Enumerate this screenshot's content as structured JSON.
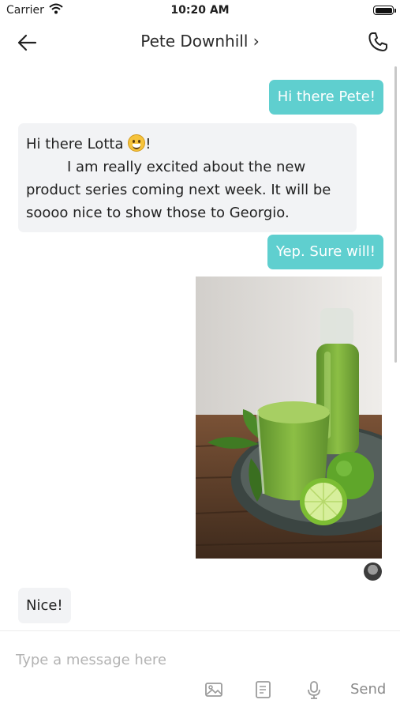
{
  "status_bar": {
    "carrier": "Carrier",
    "time": "10:20 AM"
  },
  "header": {
    "title": "Pete Downhill ›",
    "back_icon": "arrow-left-icon",
    "call_icon": "phone-icon"
  },
  "messages": [
    {
      "direction": "outgoing",
      "text": "Hi there Pete!"
    },
    {
      "direction": "incoming",
      "line1": "Hi there Lotta",
      "emoji": "grinning-face-emoji",
      "line1_end": "!",
      "body": "I am really excited about the new product series coming next week. It will be soooo nice to show those to Georgio."
    },
    {
      "direction": "outgoing",
      "text": "Yep. Sure will!"
    },
    {
      "direction": "outgoing",
      "type": "image",
      "subject": "green smoothie photo"
    },
    {
      "direction": "incoming",
      "text": "Nice!"
    }
  ],
  "composer": {
    "placeholder": "Type a message here",
    "send_label": "Send",
    "tools": [
      "image-icon",
      "document-icon",
      "microphone-icon"
    ]
  },
  "colors": {
    "outgoing_bubble": "#5fcfcf",
    "incoming_bubble": "#f2f3f5"
  }
}
